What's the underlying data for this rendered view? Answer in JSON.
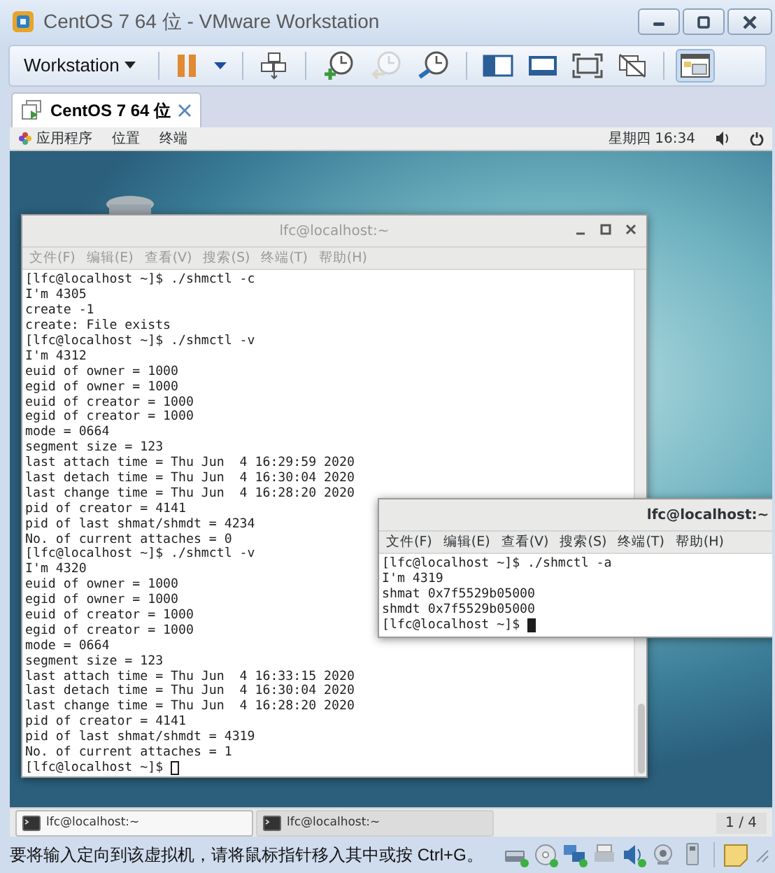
{
  "window": {
    "title": "CentOS 7 64 位 - VMware Workstation"
  },
  "toolbar": {
    "menu": "Workstation",
    "buttons": [
      {
        "kind": "pause",
        "disabled": false,
        "selected": false
      },
      {
        "kind": "caret",
        "disabled": false,
        "selected": false
      },
      {
        "kind": "sep"
      },
      {
        "kind": "send-keys",
        "disabled": false,
        "selected": false
      },
      {
        "kind": "sep"
      },
      {
        "kind": "snapshot-take",
        "disabled": false,
        "selected": false
      },
      {
        "kind": "snapshot-revert",
        "disabled": true,
        "selected": false
      },
      {
        "kind": "snapshot-manager",
        "disabled": false,
        "selected": false
      },
      {
        "kind": "sep"
      },
      {
        "kind": "sidebar",
        "disabled": false,
        "selected": false
      },
      {
        "kind": "console",
        "disabled": false,
        "selected": false
      },
      {
        "kind": "fullscreen",
        "disabled": false,
        "selected": false
      },
      {
        "kind": "unity",
        "disabled": false,
        "selected": false
      },
      {
        "kind": "sep"
      },
      {
        "kind": "thumbnail",
        "disabled": false,
        "selected": true
      }
    ]
  },
  "tabs": [
    {
      "label": "CentOS 7 64 位",
      "selected": true
    }
  ],
  "guest": {
    "top_bar": {
      "menus": [
        "应用程序",
        "位置",
        "终端"
      ],
      "clock": "星期四 16:34"
    },
    "windows": [
      {
        "title": "lfc@localhost:~",
        "focused": false,
        "has_controls": true,
        "menus": [
          "文件(F)",
          "编辑(E)",
          "查看(V)",
          "搜索(S)",
          "终端(T)",
          "帮助(H)"
        ],
        "lines": [
          "[lfc@localhost ~]$ ./shmctl -c",
          "I'm 4305",
          "create -1",
          "create: File exists",
          "[lfc@localhost ~]$ ./shmctl -v",
          "I'm 4312",
          "euid of owner = 1000",
          "egid of owner = 1000",
          "euid of creator = 1000",
          "egid of creator = 1000",
          "mode = 0664",
          "segment size = 123",
          "last attach time = Thu Jun  4 16:29:59 2020",
          "last detach time = Thu Jun  4 16:30:04 2020",
          "last change time = Thu Jun  4 16:28:20 2020",
          "pid of creator = 4141",
          "pid of last shmat/shmdt = 4234",
          "No. of current attaches = 0",
          "[lfc@localhost ~]$ ./shmctl -v",
          "I'm 4320",
          "euid of owner = 1000",
          "egid of owner = 1000",
          "euid of creator = 1000",
          "egid of creator = 1000",
          "mode = 0664",
          "segment size = 123",
          "last attach time = Thu Jun  4 16:33:15 2020",
          "last detach time = Thu Jun  4 16:30:04 2020",
          "last change time = Thu Jun  4 16:28:20 2020",
          "pid of creator = 4141",
          "pid of last shmat/shmdt = 4319",
          "No. of current attaches = 1",
          "[lfc@localhost ~]$"
        ]
      },
      {
        "title": "lfc@localhost:~",
        "focused": true,
        "has_controls": false,
        "menus": [
          "文件(F)",
          "编辑(E)",
          "查看(V)",
          "搜索(S)",
          "终端(T)",
          "帮助(H)"
        ],
        "lines": [
          "[lfc@localhost ~]$ ./shmctl -a",
          "I'm 4319",
          "shmat 0x7f5529b05000",
          "shmdt 0x7f5529b05000",
          "[lfc@localhost ~]$"
        ]
      }
    ],
    "taskbar": {
      "tasks": [
        {
          "label": "lfc@localhost:~",
          "selected": false
        },
        {
          "label": "lfc@localhost:~",
          "selected": true
        }
      ],
      "workspace": "1 / 4"
    }
  },
  "status_bar": {
    "message": "要将输入定向到该虚拟机，请将鼠标指针移入其中或按 Ctrl+G。"
  }
}
